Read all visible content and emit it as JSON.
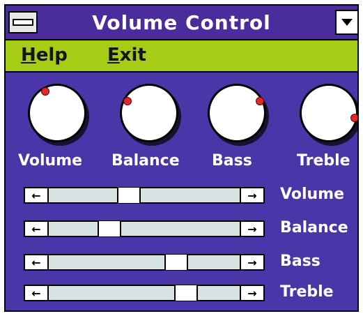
{
  "window": {
    "title": "Volume Control",
    "colors": {
      "title_bg": "#4a2c9c",
      "menu_bg": "#a6cc16",
      "client_bg": "#4a36a8",
      "knob_dot": "#e02a2a"
    }
  },
  "menu": {
    "items": [
      {
        "mnemonic": "H",
        "rest": "elp"
      },
      {
        "mnemonic": "E",
        "rest": "xit"
      }
    ]
  },
  "knobs": [
    {
      "label": "Volume",
      "angle_deg": -30
    },
    {
      "label": "Balance",
      "angle_deg": -60
    },
    {
      "label": "Bass",
      "angle_deg": 60
    },
    {
      "label": "Treble",
      "angle_deg": 100
    }
  ],
  "sliders": [
    {
      "label": "Volume",
      "position_pct": 41
    },
    {
      "label": "Balance",
      "position_pct": 29
    },
    {
      "label": "Bass",
      "position_pct": 69
    },
    {
      "label": "Treble",
      "position_pct": 75
    }
  ],
  "icons": {
    "system_menu": "system-menu-icon",
    "minimize": "minimize-icon",
    "left_arrow": "←",
    "right_arrow": "→"
  }
}
